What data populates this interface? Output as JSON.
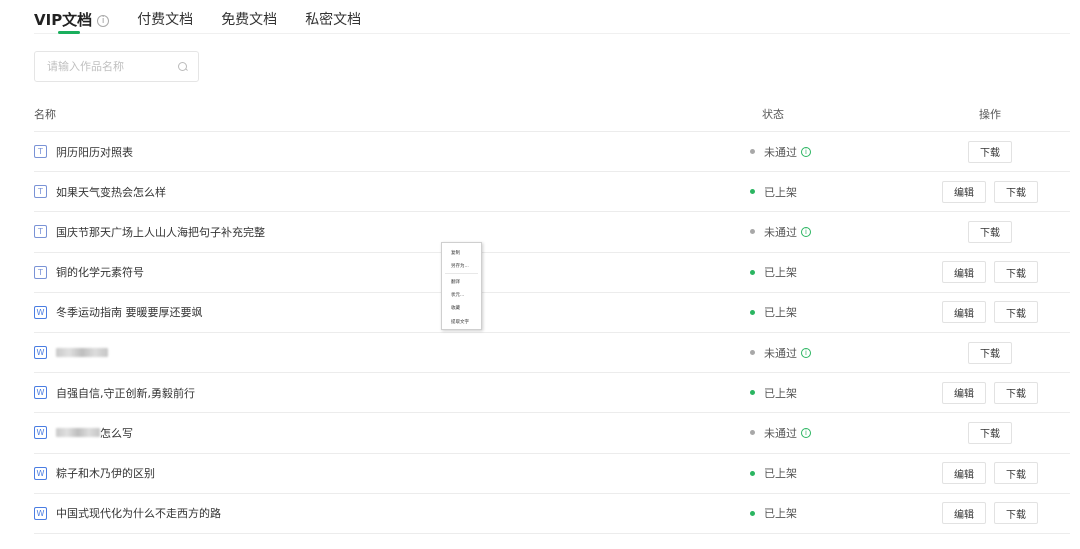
{
  "tabs": [
    {
      "label": "VIP文档",
      "active": true,
      "has_info": true
    },
    {
      "label": "付费文档",
      "active": false
    },
    {
      "label": "免费文档",
      "active": false
    },
    {
      "label": "私密文档",
      "active": false
    }
  ],
  "search": {
    "placeholder": "请输入作品名称",
    "value": ""
  },
  "table": {
    "headers": {
      "name": "名称",
      "status": "状态",
      "action": "操作"
    },
    "rows": [
      {
        "type": "T",
        "title": "阴历阳历对照表",
        "status": "未通过",
        "approved": false,
        "actions": [
          "下载"
        ]
      },
      {
        "type": "T",
        "title": "如果天气变热会怎么样",
        "status": "已上架",
        "approved": true,
        "actions": [
          "编辑",
          "下载"
        ]
      },
      {
        "type": "T",
        "title": "国庆节那天广场上人山人海把句子补充完整",
        "status": "未通过",
        "approved": false,
        "actions": [
          "下载"
        ]
      },
      {
        "type": "T",
        "title": "铜的化学元素符号",
        "status": "已上架",
        "approved": true,
        "actions": [
          "编辑",
          "下载"
        ]
      },
      {
        "type": "W",
        "title": "冬季运动指南 要暖要厚还要飒",
        "status": "已上架",
        "approved": true,
        "actions": [
          "编辑",
          "下载"
        ]
      },
      {
        "type": "W",
        "title": "",
        "status": "未通过",
        "approved": false,
        "actions": [
          "下载"
        ]
      },
      {
        "type": "W",
        "title": "自强自信,守正创新,勇毅前行",
        "status": "已上架",
        "approved": true,
        "actions": [
          "编辑",
          "下载"
        ]
      },
      {
        "type": "W",
        "title": "怎么写",
        "status": "未通过",
        "approved": false,
        "actions": [
          "下载"
        ]
      },
      {
        "type": "W",
        "title": "粽子和木乃伊的区别",
        "status": "已上架",
        "approved": true,
        "actions": [
          "编辑",
          "下载"
        ]
      },
      {
        "type": "W",
        "title": "中国式现代化为什么不走西方的路",
        "status": "已上架",
        "approved": true,
        "actions": [
          "编辑",
          "下载"
        ]
      }
    ]
  },
  "context_menu": {
    "items": [
      "复制",
      "另存为...",
      "翻译",
      "状元...",
      "收藏",
      "提取文字"
    ]
  },
  "colors": {
    "accent": "#1aaf5d",
    "approved": "#2bb561",
    "rejected": "#a8a8a8"
  }
}
